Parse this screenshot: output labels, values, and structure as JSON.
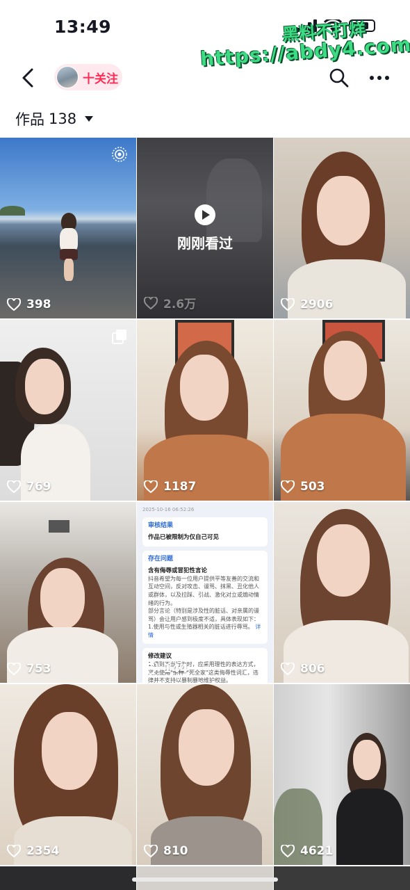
{
  "status_bar": {
    "time": "13:49"
  },
  "watermark": {
    "line1": "黑料不打烊",
    "line2": "https://abdy4.com"
  },
  "header": {
    "follow_label": "十关注"
  },
  "works": {
    "label": "作品",
    "count": "138"
  },
  "watched_label": "刚刚看过",
  "tiles": [
    {
      "likes": "398"
    },
    {
      "likes": "2.6万"
    },
    {
      "likes": "2906"
    },
    {
      "likes": "769"
    },
    {
      "likes": "1187"
    },
    {
      "likes": "503"
    },
    {
      "likes": "753"
    },
    {
      "likes": "144"
    },
    {
      "likes": "806"
    },
    {
      "likes": "2354"
    },
    {
      "likes": "810"
    },
    {
      "likes": "4621"
    }
  ],
  "doc_tile": {
    "timestamp": "2025-10-16 06:52:26",
    "review_title": "审核结果",
    "review_text": "作品已被限制为仅自己可见",
    "problem_title": "存在问题",
    "problem_heading": "含有侮辱或冒犯性言论",
    "problem_body": "抖音希望为每一位用户提供平等友善的交流和互动空间，反对攻击、谩骂、抹黑、丑化他人或群体，以及拉踩、引战、激化对立或煽动情绪的行为。",
    "problem_body2": "部分言论（特别是涉及性的脏话、对亲属的谩骂）会让用户感到极度不适，具体表现如下：",
    "problem_item": "1.使用与性或生殖器相关的脏话进行辱骂。",
    "detail_link": "详情",
    "fix_title": "修改建议",
    "fix_body": "1.遇到不当行为时，应采用理性的表达方式，避免使用\"杂种\"\"死全家\"这类侮辱性词汇，违律并不支持以暴制暴地维护权益。"
  },
  "colors": {
    "accent": "#fe2c55",
    "follow_bg": "#fde9ee",
    "watermark": "#3ddc84"
  }
}
